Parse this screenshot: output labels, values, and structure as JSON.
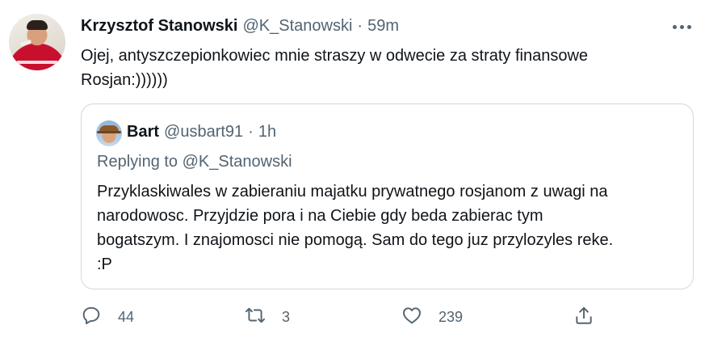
{
  "tweet": {
    "author_name": "Krzysztof Stanowski",
    "author_handle": "@K_Stanowski",
    "separator": "·",
    "time": "59m",
    "text": "Ojej, antyszczepionkowiec mnie straszy w odwecie za straty finansowe\nRosjan:))))))"
  },
  "quoted": {
    "author_name": "Bart",
    "author_handle": "@usbart91",
    "separator": "·",
    "time": "1h",
    "replying_prefix": "Replying to ",
    "replying_to": "@K_Stanowski",
    "text": "Przyklaskiwales w zabieraniu majatku prywatnego rosjanom z uwagi na\nnarodowosc. Przyjdzie pora i na Ciebie gdy beda zabierac tym\nbogatszym. I znajomosci nie pomogą. Sam do tego juz przylozyles reke.\n:P"
  },
  "actions": {
    "replies": "44",
    "retweets": "3",
    "likes": "239"
  },
  "icons": {
    "more": "more-dots-icon",
    "reply": "reply-bubble-icon",
    "retweet": "retweet-icon",
    "like": "heart-icon",
    "share": "share-upload-icon"
  },
  "colors": {
    "text": "#0f1419",
    "secondary": "#536471",
    "border": "#cfd9de"
  }
}
